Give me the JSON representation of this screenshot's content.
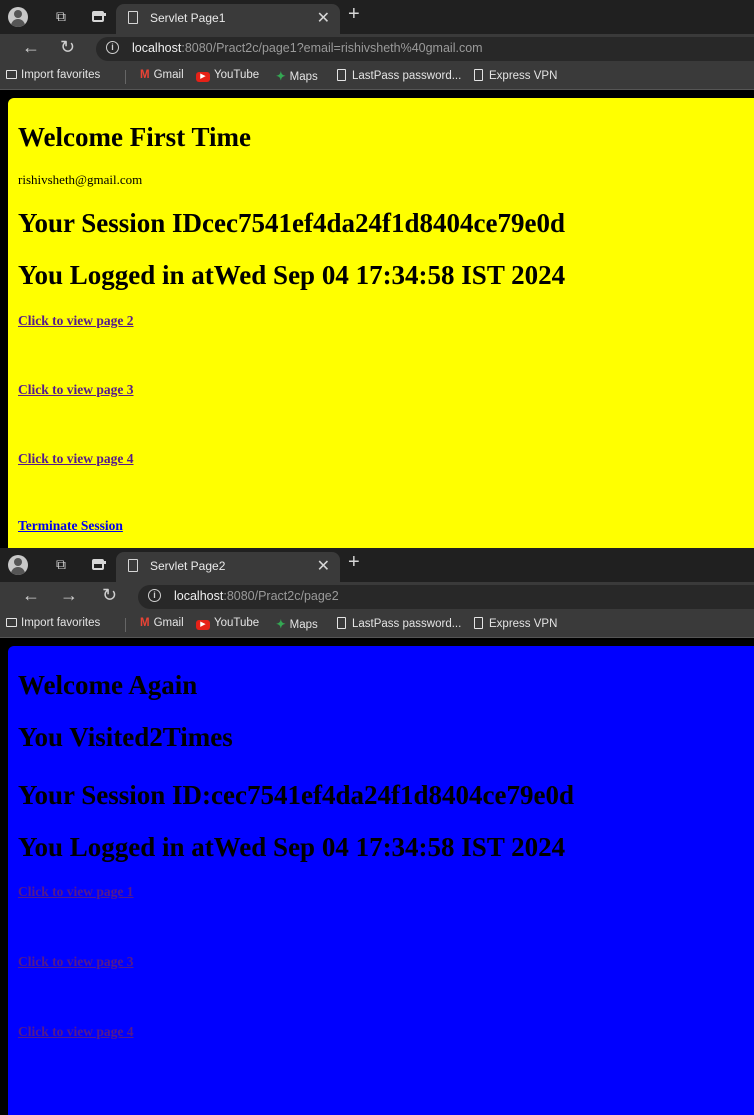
{
  "bookmarks": [
    "Import favorites",
    "Gmail",
    "YouTube",
    "Maps",
    "LastPass password...",
    "Express VPN"
  ],
  "window1": {
    "tab_title": "Servlet Page1",
    "url_host": "localhost",
    "url_rest": ":8080/Pract2c/page1?email=rishivsheth%40gmail.com",
    "bg_color": "#ffff00",
    "heading": "Welcome First Time",
    "email": "rishivsheth@gmail.com",
    "session": "Your Session IDcec7541ef4da24f1d8404ce79e0d",
    "logged_in": "You Logged in atWed Sep 04 17:34:58 IST 2024",
    "links": [
      "Click to view page 2",
      "Click to view page 3",
      "Click to view page 4",
      "Terminate Session"
    ]
  },
  "window2": {
    "tab_title": "Servlet Page2",
    "url_host": "localhost",
    "url_rest": ":8080/Pract2c/page2",
    "bg_color": "#0000ff",
    "heading": "Welcome Again",
    "visited": "You Visited2Times",
    "session": "Your Session ID:cec7541ef4da24f1d8404ce79e0d",
    "logged_in": "You Logged in atWed Sep 04 17:34:58 IST 2024",
    "links": [
      "Click to view page 1",
      "Click to view page 3",
      "Click to view page 4"
    ]
  }
}
